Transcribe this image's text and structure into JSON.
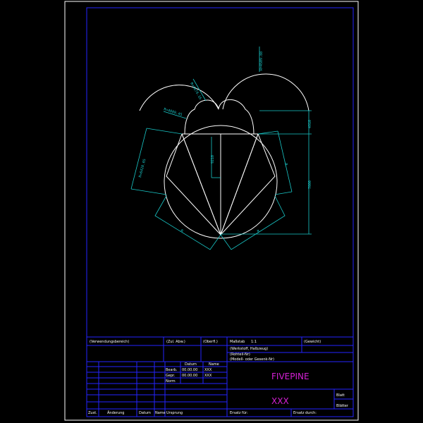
{
  "drawing": {
    "dimensions": {
      "top_radius": "R=4509.88",
      "top_left_radius": "R=4679.16",
      "head_left": "R=4089.45",
      "side_left": "R=6420.65",
      "center_v": "9210",
      "right_upper": "4910",
      "right_total": "7000",
      "bottom_left": "R",
      "bottom_right": "R",
      "right_mid": "R"
    }
  },
  "title_block": {
    "verwendungsbereich": "(Verwendungsbereich)",
    "zul_abw": "(Zul. Abw.)",
    "oberfl": "(Oberfl.)",
    "massstab": "Maßstab",
    "massstab_value": "1:1",
    "gewicht": "(Gewicht)",
    "werkstoff": "(Werkstoff, Halbzeug)",
    "rohteil": "(Rohteil-Nr)",
    "modell": "(Modell- oder Gesenk-Nr)",
    "datum_header": "Datum",
    "name_header": "Name",
    "bearb": "Bearb.",
    "gepr": "Gepr.",
    "norm": "Norm",
    "bearb_date": "00.00.00",
    "bearb_name": "XXX",
    "gepr_date": "00.00.00",
    "gepr_name": "XXX",
    "company": "FIVEPINE",
    "drawing_no": "XXX",
    "blatt": "Blatt",
    "blaetter": "Blätter",
    "zust": "Zust.",
    "aenderung": "Änderung",
    "datum_footer": "Datum",
    "name_footer": "Name",
    "ursprung": "Ursprung",
    "ersatz_fuer": "Ersatz für:",
    "ersatz_durch": "Ersatz durch:"
  }
}
